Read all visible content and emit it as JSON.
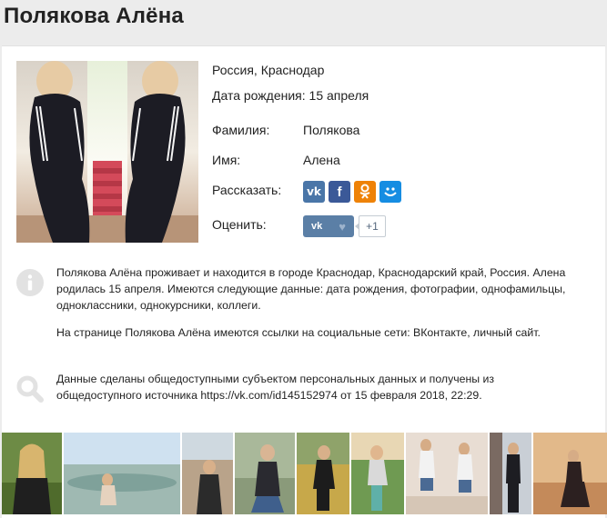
{
  "page": {
    "title": "Полякова Алёна"
  },
  "profile": {
    "location": "Россия, Краснодар",
    "birthday": "Дата рождения: 15 апреля",
    "surname_label": "Фамилия:",
    "surname_value": "Полякова",
    "name_label": "Имя:",
    "name_value": "Алена",
    "share_label": "Рассказать:",
    "rate_label": "Оценить:",
    "rate_count": "+1"
  },
  "share_buttons": [
    {
      "icon": "vk-icon",
      "glyph": "vk",
      "color": "#4a76a8"
    },
    {
      "icon": "facebook-icon",
      "glyph": "f",
      "color": "#3b5998"
    },
    {
      "icon": "odnoklassniki-icon",
      "glyph": "ок",
      "color": "#ee8208"
    },
    {
      "icon": "moimir-icon",
      "glyph": "@",
      "color": "#168de2"
    }
  ],
  "info_block": {
    "icon": "info-icon",
    "paragraph1": "Полякова Алёна проживает и находится в городе Краснодар, Краснодарский край, Россия. Алена родилась 15 апреля. Имеются следующие данные: дата рождения, фотографии, однофамильцы, одноклассники, однокурсники, коллеги.",
    "paragraph2": "На странице Полякова Алёна имеются ссылки на социальные сети: ВКонтакте, личный сайт."
  },
  "source_block": {
    "icon": "search-icon",
    "text": "Данные сделаны общедоступными субъектом персональных данных и получены из общедоступного источника https://vk.com/id145152974 от 15 февраля 2018, 22:29."
  },
  "colors": {
    "vk": "#4a76a8",
    "rate_button": "#5b7fa6",
    "icon_gray": "#e0e0e0"
  },
  "gallery": {
    "photos": [
      {
        "name": "gallery-photo-1"
      },
      {
        "name": "gallery-photo-2"
      },
      {
        "name": "gallery-photo-3"
      },
      {
        "name": "gallery-photo-4"
      },
      {
        "name": "gallery-photo-5"
      },
      {
        "name": "gallery-photo-6"
      },
      {
        "name": "gallery-photo-7"
      },
      {
        "name": "gallery-photo-8"
      },
      {
        "name": "gallery-photo-9"
      }
    ]
  }
}
